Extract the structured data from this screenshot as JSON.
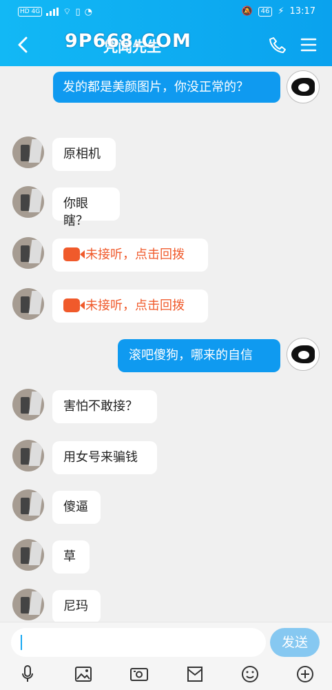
{
  "status": {
    "left": "HD 4G",
    "time": "13:17",
    "battery": "46"
  },
  "header": {
    "title": "凭闻先生",
    "watermark": "9P668.COM"
  },
  "messages": [
    {
      "side": "right",
      "text": "发的都是美颜图片，你没正常的？"
    },
    {
      "side": "left",
      "text": "原相机"
    },
    {
      "side": "left",
      "text": "你眼瞎？"
    },
    {
      "side": "left",
      "text": "未接听，点击回拨",
      "missed": true
    },
    {
      "side": "left",
      "text": "未接听，点击回拨",
      "missed": true
    },
    {
      "side": "right",
      "text": "滚吧傻狗，哪来的自信"
    },
    {
      "side": "left",
      "text": "害怕不敢接？"
    },
    {
      "side": "left",
      "text": "用女号来骗钱"
    },
    {
      "side": "left",
      "text": "傻逼"
    },
    {
      "side": "left",
      "text": "草"
    },
    {
      "side": "left",
      "text": "尼玛"
    }
  ],
  "composer": {
    "send_label": "发送"
  },
  "icons": [
    "back-icon",
    "phone-icon",
    "menu-icon",
    "voice-icon",
    "image-icon",
    "camera-icon",
    "folder-icon",
    "emoji-icon",
    "add-icon"
  ]
}
